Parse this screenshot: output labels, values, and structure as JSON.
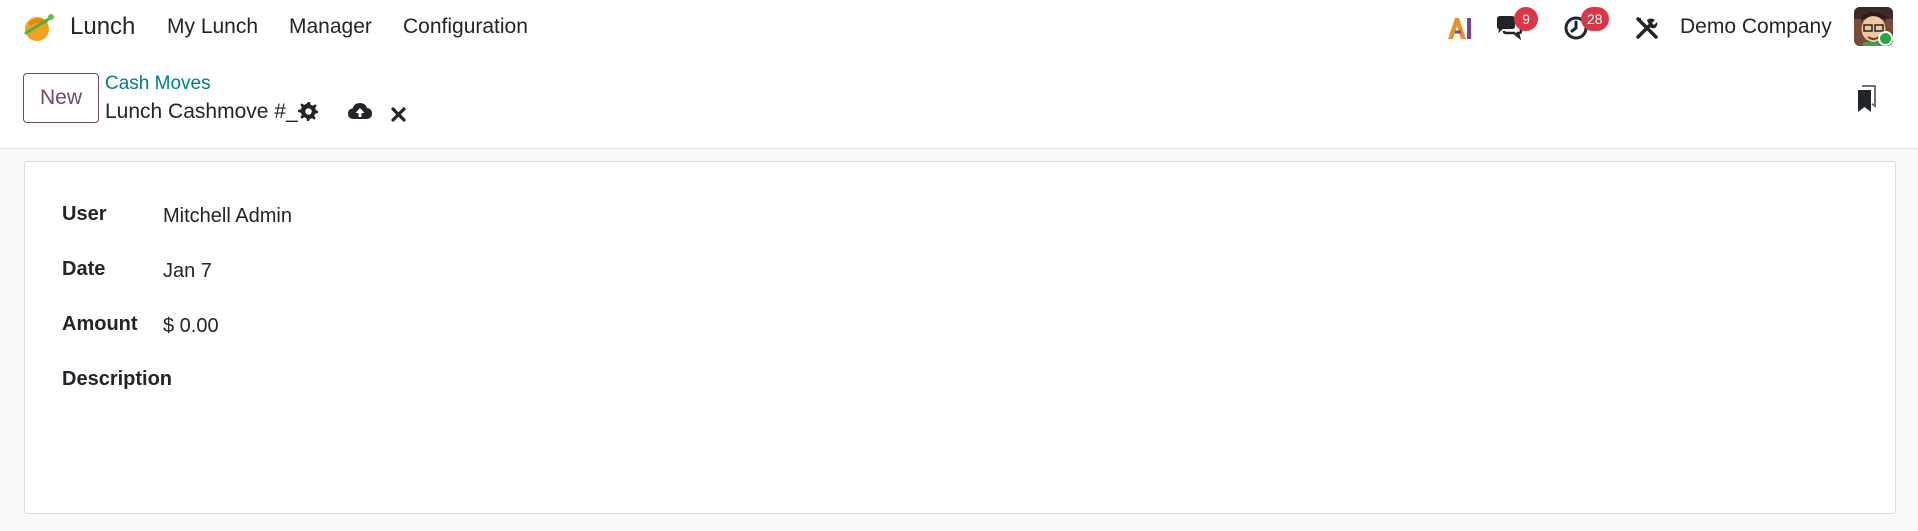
{
  "navbar": {
    "app_name": "Lunch",
    "menu": [
      "My Lunch",
      "Manager",
      "Configuration"
    ],
    "ai_label": "AI",
    "messages_count": "9",
    "activities_count": "28",
    "company": "Demo Company"
  },
  "control_panel": {
    "new_label": "New",
    "breadcrumb_parent": "Cash Moves",
    "breadcrumb_current": "Lunch Cashmove #_"
  },
  "form": {
    "fields": [
      {
        "label": "User",
        "value": "Mitchell Admin"
      },
      {
        "label": "Date",
        "value": "Jan 7"
      },
      {
        "label": "Amount",
        "value": "$ 0.00"
      },
      {
        "label": "Description",
        "value": ""
      }
    ]
  },
  "colors": {
    "brand": "#714b67",
    "link": "#017e84",
    "badge": "#dc3545",
    "online": "#28a745"
  },
  "icons": [
    "lunch-app-icon",
    "ai-icon",
    "chat-icon",
    "clock-icon",
    "tools-icon",
    "gear-icon",
    "cloud-upload-icon",
    "close-icon",
    "bookmark-icon"
  ]
}
